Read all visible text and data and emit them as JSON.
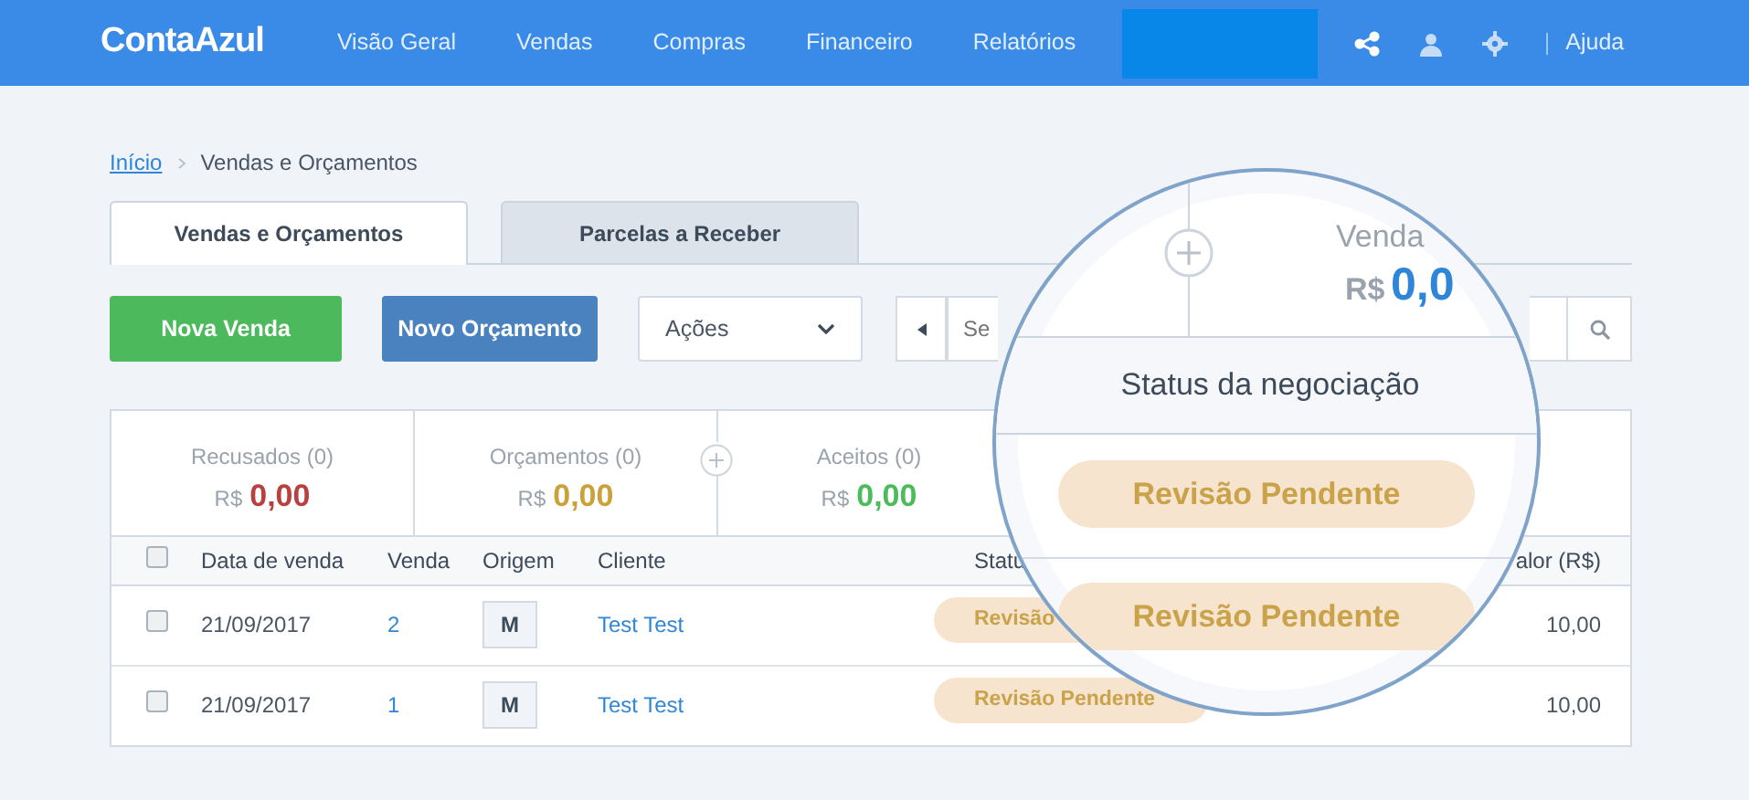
{
  "nav": {
    "logo": "ContaAzul",
    "items": [
      {
        "label": "Visão Geral"
      },
      {
        "label": "Vendas"
      },
      {
        "label": "Compras"
      },
      {
        "label": "Financeiro"
      },
      {
        "label": "Relatórios"
      }
    ],
    "help": "Ajuda"
  },
  "breadcrumb": [
    {
      "label": "Início",
      "link": true
    },
    {
      "label": "Vendas e Orçamentos",
      "link": false
    }
  ],
  "tabs": [
    {
      "label": "Vendas e Orçamentos",
      "selected": true
    },
    {
      "label": "Parcelas a Receber",
      "selected": false
    }
  ],
  "toolbar": {
    "buttons": [
      {
        "label": "Nova Venda",
        "kind": "success"
      },
      {
        "label": "Novo Orçamento",
        "kind": "primary"
      }
    ],
    "actions": "Ações",
    "search": {
      "placeholder": "Se"
    }
  },
  "summary": [
    {
      "label": "Recusados (0)",
      "currency": "R$",
      "value": "0,00",
      "color": "#b8403f"
    },
    {
      "label": "Orçamentos (0)",
      "currency": "R$",
      "value": "0,00",
      "color": "#c9a23a"
    },
    {
      "label": "Aceitos (0)",
      "currency": "R$",
      "value": "0,00",
      "color": "#4cbb5c"
    }
  ],
  "table": {
    "select_all": {
      "checked": false
    },
    "columns": [
      "Data de venda",
      "Venda",
      "Origem",
      "Cliente",
      "Statu",
      "alor (R$)"
    ],
    "rows": [
      {
        "checked": false,
        "date": "21/09/2017",
        "number": "2",
        "origin": "M",
        "client": "Test Test",
        "status": "Revisão",
        "value": "10,00"
      },
      {
        "checked": false,
        "date": "21/09/2017",
        "number": "1",
        "origin": "M",
        "client": "Test Test",
        "status": "Revisão Pendente",
        "value": "10,00"
      }
    ]
  },
  "magnifier": {
    "title": "Venda",
    "currency": "R$",
    "value": "0,0",
    "column": "Status da negociação",
    "badges": [
      "Revisão Pendente",
      "Revisão Pendente"
    ]
  }
}
